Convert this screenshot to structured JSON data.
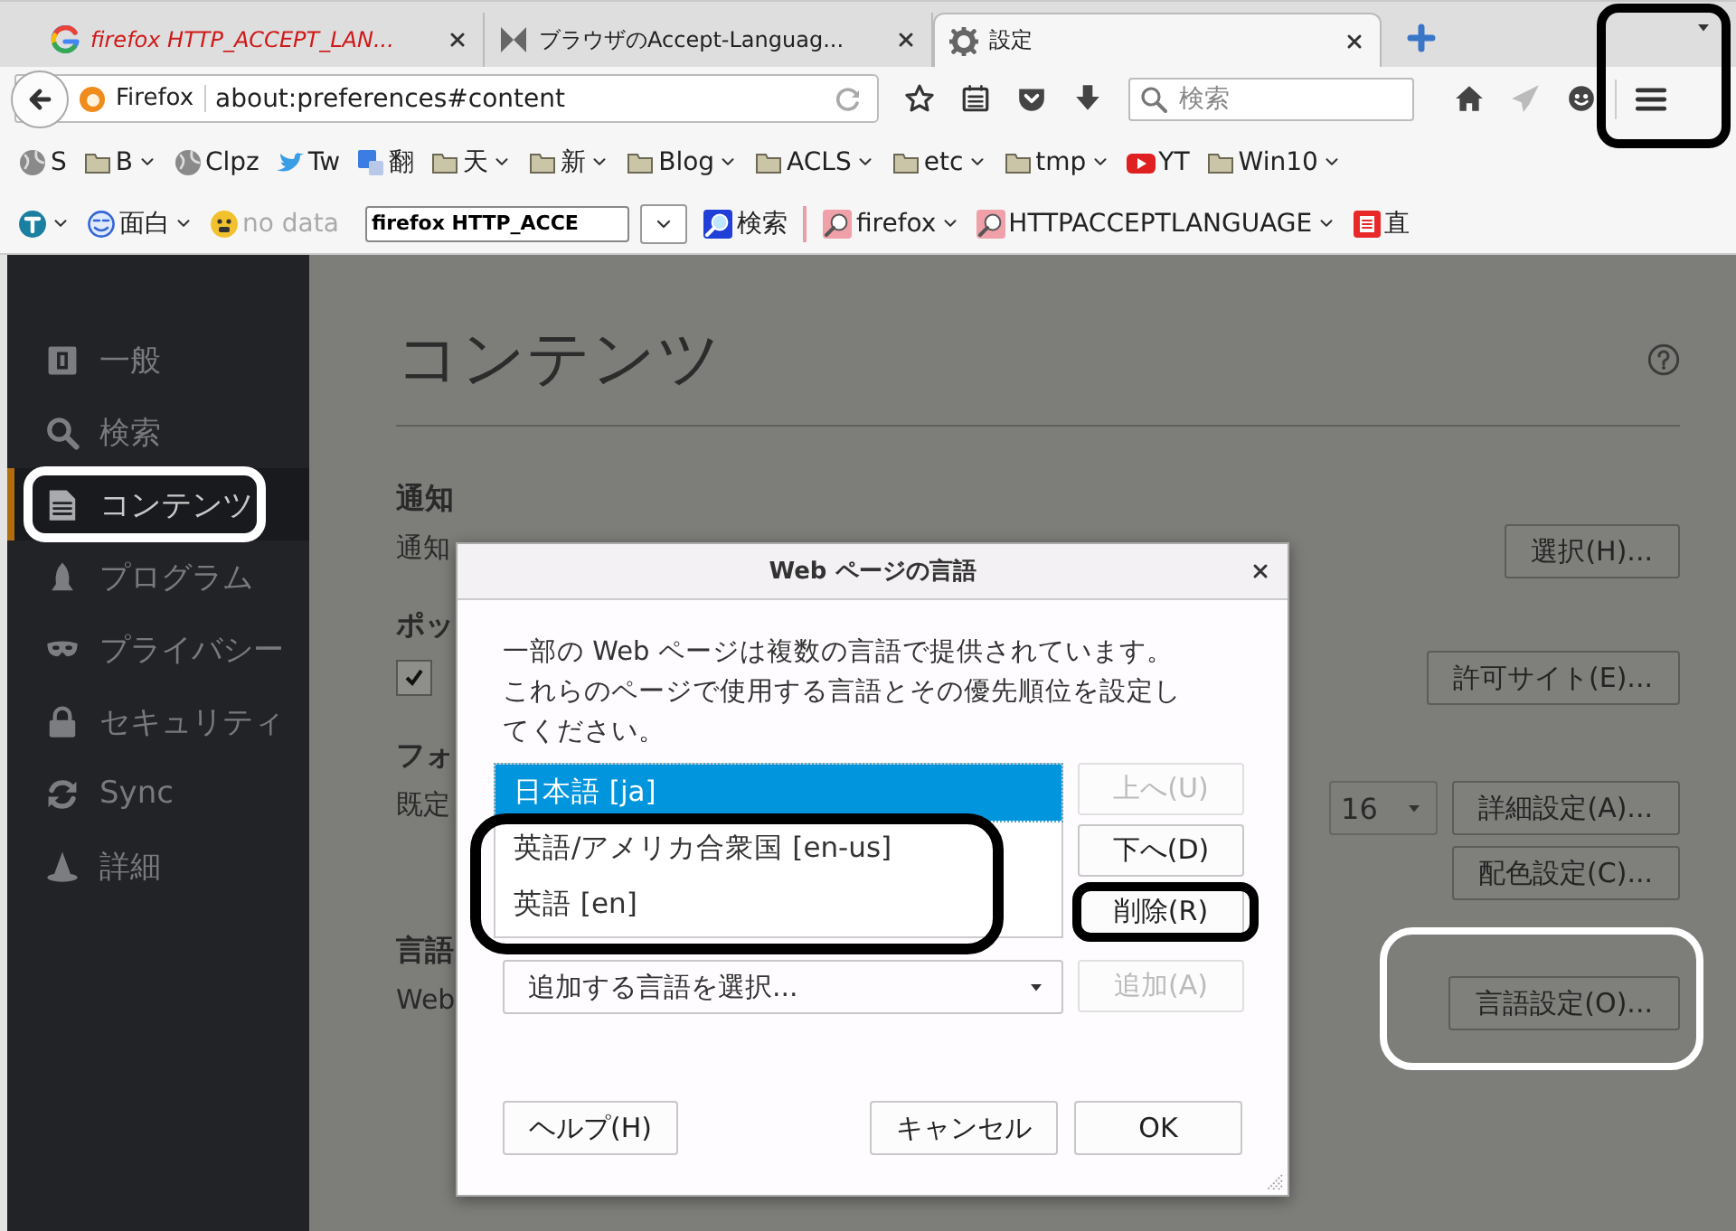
{
  "tabs": [
    {
      "title": "firefox HTTP_ACCEPT_LAN...",
      "emphasized": true,
      "selected": false
    },
    {
      "title": "ブラウザのAccept-Languag...",
      "emphasized": false,
      "selected": false
    },
    {
      "title": "設定",
      "emphasized": false,
      "selected": true
    }
  ],
  "url_bar": {
    "identity": "Firefox",
    "url": "about:preferences#content"
  },
  "search": {
    "placeholder": "検索"
  },
  "bookmarks": [
    {
      "label": "S",
      "menu": false
    },
    {
      "label": "B",
      "menu": true
    },
    {
      "label": "Clpz",
      "menu": false
    },
    {
      "label": "Tw",
      "menu": false
    },
    {
      "label": "翻",
      "menu": false
    },
    {
      "label": "天",
      "menu": true
    },
    {
      "label": "新",
      "menu": true
    },
    {
      "label": "Blog",
      "menu": true
    },
    {
      "label": "ACLS",
      "menu": true
    },
    {
      "label": "etc",
      "menu": true
    },
    {
      "label": "tmp",
      "menu": true
    },
    {
      "label": "YT",
      "menu": false
    },
    {
      "label": "Win10",
      "menu": true
    }
  ],
  "toolbar": [
    {
      "kind": "button",
      "menu": true
    },
    {
      "kind": "button",
      "label": "面白",
      "menu": true
    },
    {
      "kind": "status",
      "label": "no data",
      "menu": false
    },
    {
      "kind": "input",
      "value": "firefox HTTP_ACCE"
    },
    {
      "kind": "dropdown"
    },
    {
      "kind": "button",
      "label": "検索",
      "menu": false
    },
    {
      "kind": "separator"
    },
    {
      "kind": "button",
      "label": "firefox",
      "menu": true
    },
    {
      "kind": "button",
      "label": "HTTPACCEPTLANGUAGE",
      "menu": true
    },
    {
      "kind": "button",
      "label": "直",
      "menu": false
    }
  ],
  "sidebar": {
    "items": [
      {
        "label": "一般",
        "selected": false
      },
      {
        "label": "検索",
        "selected": false
      },
      {
        "label": "コンテンツ",
        "selected": true
      },
      {
        "label": "プログラム",
        "selected": false
      },
      {
        "label": "プライバシー",
        "selected": false
      },
      {
        "label": "セキュリティ",
        "selected": false
      },
      {
        "label": "Sync",
        "selected": false
      },
      {
        "label": "詳細",
        "selected": false
      }
    ]
  },
  "content": {
    "heading": "コンテンツ",
    "sections": [
      {
        "title": "通知",
        "description": "通知",
        "buttons": [
          "選択(H)..."
        ]
      },
      {
        "title": "ポッ",
        "checkbox": {
          "checked": true
        },
        "buttons": [
          "許可サイト(E)..."
        ]
      },
      {
        "title": "フォ",
        "description": "既定",
        "size": "16",
        "buttons": [
          "詳細設定(A)...",
          "配色設定(C)..."
        ]
      },
      {
        "title": "言語",
        "description": "Web",
        "buttons": [
          "言語設定(O)..."
        ]
      }
    ]
  },
  "dialog": {
    "title": "Web ページの言語",
    "description": "一部の Web ページは複数の言語で提供されています。これらのページで使用する言語とその優先順位を設定してください。",
    "languages": [
      {
        "label": "日本語 [ja]",
        "selected": true
      },
      {
        "label": "英語/アメリカ合衆国 [en-us]",
        "selected": false
      },
      {
        "label": "英語 [en]",
        "selected": false
      }
    ],
    "order_buttons": [
      {
        "label": "上へ(U)",
        "disabled": true
      },
      {
        "label": "下へ(D)",
        "disabled": false
      },
      {
        "label": "削除(R)",
        "disabled": false
      }
    ],
    "add_select": {
      "placeholder": "追加する言語を選択..."
    },
    "add_button": {
      "label": "追加(A)",
      "disabled": true
    },
    "footer_buttons": [
      {
        "label": "ヘルプ(H)"
      },
      {
        "label": "キャンセル"
      },
      {
        "label": "OK"
      }
    ]
  }
}
